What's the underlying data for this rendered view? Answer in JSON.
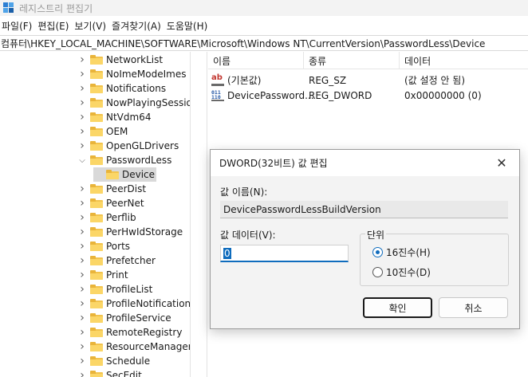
{
  "window": {
    "title": "레지스트리 편집기"
  },
  "menu": [
    "파일(F)",
    "편집(E)",
    "보기(V)",
    "즐겨찾기(A)",
    "도움말(H)"
  ],
  "address": "컴퓨터\\HKEY_LOCAL_MACHINE\\SOFTWARE\\Microsoft\\Windows NT\\CurrentVersion\\PasswordLess\\Device",
  "tree": [
    {
      "label": "NetworkList",
      "expanded": false
    },
    {
      "label": "NoImeModeImes",
      "expanded": false
    },
    {
      "label": "Notifications",
      "expanded": false
    },
    {
      "label": "NowPlayingSessionManager",
      "expanded": false
    },
    {
      "label": "NtVdm64",
      "expanded": false
    },
    {
      "label": "OEM",
      "expanded": false
    },
    {
      "label": "OpenGLDrivers",
      "expanded": false
    },
    {
      "label": "PasswordLess",
      "expanded": true
    },
    {
      "label": "Device",
      "child": true,
      "selected": true
    },
    {
      "label": "PeerDist",
      "expanded": false
    },
    {
      "label": "PeerNet",
      "expanded": false
    },
    {
      "label": "Perflib",
      "expanded": false
    },
    {
      "label": "PerHwIdStorage",
      "expanded": false
    },
    {
      "label": "Ports",
      "expanded": false
    },
    {
      "label": "Prefetcher",
      "expanded": false
    },
    {
      "label": "Print",
      "expanded": false
    },
    {
      "label": "ProfileList",
      "expanded": false
    },
    {
      "label": "ProfileNotification",
      "expanded": false
    },
    {
      "label": "ProfileService",
      "expanded": false
    },
    {
      "label": "RemoteRegistry",
      "expanded": false
    },
    {
      "label": "ResourceManager",
      "expanded": false
    },
    {
      "label": "Schedule",
      "expanded": false
    },
    {
      "label": "SecEdit",
      "expanded": false
    }
  ],
  "list": {
    "headers": {
      "name": "이름",
      "type": "종류",
      "data": "데이터"
    },
    "rows": [
      {
        "icon": "string-value-icon",
        "name": "(기본값)",
        "type": "REG_SZ",
        "data": "(값 설정 안 됨)"
      },
      {
        "icon": "binary-value-icon",
        "name": "DevicePassword...",
        "type": "REG_DWORD",
        "data": "0x00000000 (0)"
      }
    ]
  },
  "dialog": {
    "title": "DWORD(32비트) 값 편집",
    "close_glyph": "✕",
    "value_name_label": "값 이름(N):",
    "value_name": "DevicePasswordLessBuildVersion",
    "value_data_label": "값 데이터(V):",
    "value_data": "0",
    "base_label": "단위",
    "base_hex": "16진수(H)",
    "base_dec": "10진수(D)",
    "base_selected": "hex",
    "ok": "확인",
    "cancel": "취소"
  },
  "colors": {
    "accent": "#0f6cbd",
    "folder": "#f2c34d"
  }
}
